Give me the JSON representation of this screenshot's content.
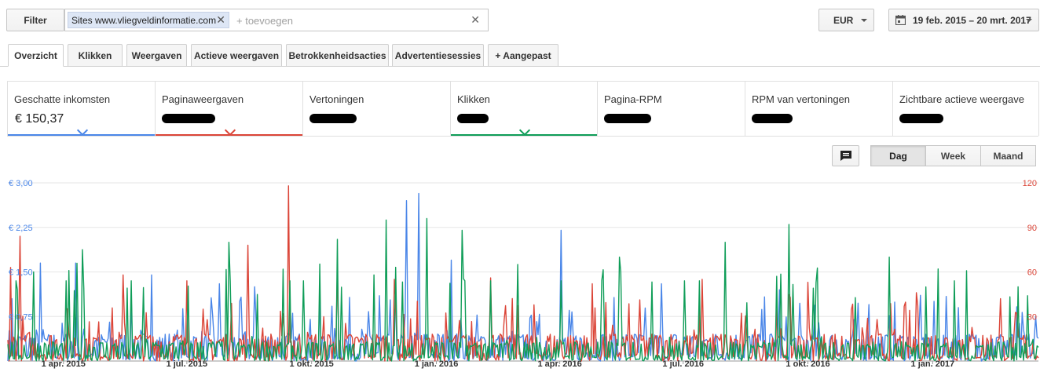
{
  "filter": {
    "button_label": "Filter",
    "chip_label": "Sites www.vliegveldinformatie.com",
    "chip_remove": "✕",
    "input_placeholder": "+ toevoegen",
    "clear_label": "✕"
  },
  "currency": {
    "selected": "EUR"
  },
  "date_range": {
    "label": "19 feb. 2015 – 20 mrt. 2017"
  },
  "tabs": [
    {
      "label": "Overzicht",
      "active": true
    },
    {
      "label": "Klikken"
    },
    {
      "label": "Weergaven"
    },
    {
      "label": "Actieve weergaven"
    },
    {
      "label": "Betrokkenheidsacties"
    },
    {
      "label": "Advertentiesessies"
    },
    {
      "label": "+  Aangepast"
    }
  ],
  "scorecards": [
    {
      "label": "Geschatte inkomsten",
      "value": "€ 150,37",
      "color": "#4a86e8",
      "selected": true
    },
    {
      "label": "Paginaweergaven",
      "value": "",
      "color": "#db4437",
      "selected": true
    },
    {
      "label": "Vertoningen",
      "value": ""
    },
    {
      "label": "Klikken",
      "value": "",
      "color": "#0f9d58",
      "selected": true
    },
    {
      "label": "Pagina-RPM",
      "value": ""
    },
    {
      "label": "RPM van vertoningen",
      "value": ""
    },
    {
      "label": "Zichtbare actieve weergave",
      "value": ""
    }
  ],
  "toolbar": {
    "annotation_icon": "comment-icon",
    "granularity": [
      {
        "label": "Dag",
        "active": true
      },
      {
        "label": "Week"
      },
      {
        "label": "Maand"
      }
    ]
  },
  "colors": {
    "revenue": "#4a86e8",
    "pageviews": "#db4437",
    "clicks": "#0f9d58"
  },
  "chart_data": {
    "type": "line",
    "x_range": [
      "2015-02-19",
      "2017-03-20"
    ],
    "x_ticks": [
      "1 apr. 2015",
      "1 jul. 2015",
      "1 okt. 2015",
      "1 jan. 2016",
      "1 apr. 2016",
      "1 jul. 2016",
      "1 okt. 2016",
      "1 jan. 2017"
    ],
    "y_left_ticks": [
      "€ 0,75",
      "€ 1,50",
      "€ 2,25",
      "€ 3,00"
    ],
    "y_left_range": [
      0,
      3
    ],
    "y_right_ticks": [
      "30",
      "60",
      "90",
      "120"
    ],
    "y_right_range": [
      0,
      120
    ],
    "grid": true,
    "series": [
      {
        "color": "#4a86e8",
        "axis": "left",
        "peaks": [
          {
            "date": "2015-02-22",
            "y": 1.05
          },
          {
            "date": "2015-03-15",
            "y": 1.65
          },
          {
            "date": "2015-04-10",
            "y": 1.65
          },
          {
            "date": "2015-06-05",
            "y": 1.45
          },
          {
            "date": "2015-07-25",
            "y": 1.3
          },
          {
            "date": "2015-08-20",
            "y": 1.25
          },
          {
            "date": "2015-11-20",
            "y": 1.1
          },
          {
            "date": "2015-12-10",
            "y": 2.7
          },
          {
            "date": "2015-12-19",
            "y": 2.82
          },
          {
            "date": "2016-01-12",
            "y": 1.7
          },
          {
            "date": "2016-04-02",
            "y": 2.2
          },
          {
            "date": "2016-06-15",
            "y": 1.3
          },
          {
            "date": "2016-09-10",
            "y": 1.2
          },
          {
            "date": "2016-11-15",
            "y": 0.95
          },
          {
            "date": "2017-01-20",
            "y": 0.9
          },
          {
            "date": "2017-03-18",
            "y": 0.75
          }
        ],
        "baseline": 0.35
      },
      {
        "color": "#db4437",
        "axis": "right",
        "peaks": [
          {
            "date": "2015-02-21",
            "y": 63
          },
          {
            "date": "2015-02-28",
            "y": 84
          },
          {
            "date": "2015-05-15",
            "y": 58
          },
          {
            "date": "2015-07-01",
            "y": 54
          },
          {
            "date": "2015-08-15",
            "y": 78
          },
          {
            "date": "2015-09-14",
            "y": 118
          },
          {
            "date": "2015-10-20",
            "y": 62
          },
          {
            "date": "2015-12-01",
            "y": 55
          },
          {
            "date": "2016-02-10",
            "y": 56
          },
          {
            "date": "2016-04-25",
            "y": 52
          },
          {
            "date": "2016-07-15",
            "y": 55
          },
          {
            "date": "2016-10-01",
            "y": 53
          },
          {
            "date": "2016-12-20",
            "y": 46
          },
          {
            "date": "2017-02-20",
            "y": 42
          }
        ],
        "baseline": 14
      },
      {
        "color": "#0f9d58",
        "axis": "right",
        "peaks": [
          {
            "date": "2015-03-10",
            "y": 60
          },
          {
            "date": "2015-04-15",
            "y": 75
          },
          {
            "date": "2015-08-01",
            "y": 80
          },
          {
            "date": "2015-10-20",
            "y": 82
          },
          {
            "date": "2015-11-25",
            "y": 95
          },
          {
            "date": "2015-12-25",
            "y": 96
          },
          {
            "date": "2016-01-20",
            "y": 88
          },
          {
            "date": "2016-03-01",
            "y": 65
          },
          {
            "date": "2016-05-15",
            "y": 70
          },
          {
            "date": "2016-08-01",
            "y": 80
          },
          {
            "date": "2016-09-17",
            "y": 92
          },
          {
            "date": "2016-11-30",
            "y": 70
          },
          {
            "date": "2017-01-05",
            "y": 62
          },
          {
            "date": "2017-03-05",
            "y": 50
          }
        ],
        "baseline": 10
      }
    ]
  }
}
